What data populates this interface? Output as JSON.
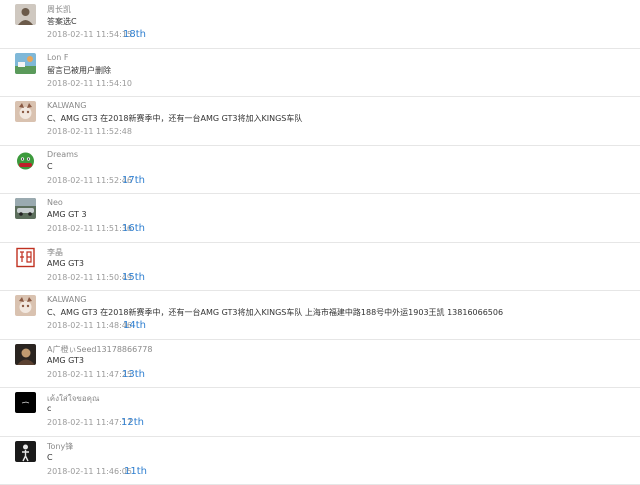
{
  "colors": {
    "floor_link": "#2f7fd0",
    "divider": "#e6e6e6"
  },
  "comments": [
    {
      "name": "周长凯",
      "message": "答案选C",
      "time": "2018-02-11 11:54:15",
      "floor": "18th",
      "avatar": {
        "icon": "portrait-avatar",
        "bg": "#cfc8c0",
        "fg": "#6b5a4a"
      }
    },
    {
      "name": "Lon F",
      "message": "留言已被用户删除",
      "time": "2018-02-11 11:54:10",
      "floor": "",
      "avatar": {
        "icon": "landscape-avatar",
        "bg": "#7fb8d8",
        "fg": "#e8a65a"
      }
    },
    {
      "name": "KALWANG",
      "message": "C、AMG GT3 在2018新赛季中，还有一台AMG GT3将加入KINGS车队",
      "time": "2018-02-11 11:52:48",
      "floor": "",
      "avatar": {
        "icon": "pet-avatar",
        "bg": "#d9c2b0",
        "fg": "#8a5a44"
      }
    },
    {
      "name": "Dreams",
      "message": "C",
      "time": "2018-02-11 11:52:46",
      "floor": "17th",
      "avatar": {
        "icon": "cartoon-face-avatar",
        "bg": "#ffffff",
        "fg": "#3c9a3c"
      }
    },
    {
      "name": "Neo",
      "message": "AMG GT 3",
      "time": "2018-02-11 11:51:36",
      "floor": "16th",
      "avatar": {
        "icon": "car-avatar",
        "bg": "#5c6e5c",
        "fg": "#c8ced0"
      }
    },
    {
      "name": "李晶",
      "message": "AMG GT3",
      "time": "2018-02-11 11:50:49",
      "floor": "15th",
      "avatar": {
        "icon": "seal-stamp-avatar",
        "bg": "#ffffff",
        "fg": "#c03020"
      }
    },
    {
      "name": "KALWANG",
      "message": "C、AMG GT3 在2018新赛季中，还有一台AMG GT3将加入KINGS车队 上海市福建中路188号中外运1903王凯 13816066506",
      "time": "2018-02-11 11:48:46",
      "floor": "14th",
      "avatar": {
        "icon": "pet-avatar",
        "bg": "#d9c2b0",
        "fg": "#8a5a44"
      }
    },
    {
      "name": "A广橙ぃSeed13178866778",
      "message": "AMG GT3",
      "time": "2018-02-11 11:47:25",
      "floor": "13th",
      "avatar": {
        "icon": "dark-portrait-avatar",
        "bg": "#2a2420",
        "fg": "#c09a70"
      }
    },
    {
      "name": "เค้งใส่ใจขอคุณ",
      "message": "c",
      "time": "2018-02-11 11:47:17",
      "floor": "12th",
      "avatar": {
        "icon": "black-avatar",
        "bg": "#000000",
        "fg": "#d8d8d8"
      }
    },
    {
      "name": "Tony锋",
      "message": "C",
      "time": "2018-02-11 11:46:05",
      "floor": "11th",
      "avatar": {
        "icon": "figure-avatar",
        "bg": "#1a1a1a",
        "fg": "#e8e8e8"
      }
    }
  ]
}
